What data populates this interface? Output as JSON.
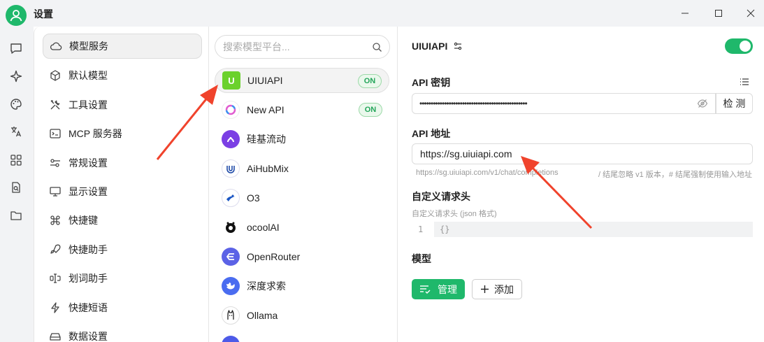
{
  "window": {
    "title": "设置"
  },
  "colors": {
    "accent": "#1fb86b",
    "arrow": "#f0432c"
  },
  "rail": {
    "icons": [
      "chat-icon",
      "sparkle-icon",
      "palette-icon",
      "translate-icon",
      "apps-grid-icon",
      "doc-search-icon",
      "folder-icon"
    ]
  },
  "nav": {
    "items": [
      {
        "label": "模型服务",
        "icon": "cloud-icon"
      },
      {
        "label": "默认模型",
        "icon": "cube-icon"
      },
      {
        "label": "工具设置",
        "icon": "tools-icon"
      },
      {
        "label": "MCP 服务器",
        "icon": "terminal-icon"
      },
      {
        "label": "常规设置",
        "icon": "sliders-icon"
      },
      {
        "label": "显示设置",
        "icon": "monitor-icon"
      },
      {
        "label": "快捷键",
        "icon": "command-icon"
      },
      {
        "label": "快捷助手",
        "icon": "rocket-icon"
      },
      {
        "label": "划词助手",
        "icon": "text-cursor-icon"
      },
      {
        "label": "快捷短语",
        "icon": "zap-icon"
      },
      {
        "label": "数据设置",
        "icon": "database-icon"
      }
    ]
  },
  "providers": {
    "search_placeholder": "搜索模型平台...",
    "on_label": "ON",
    "items": [
      {
        "name": "UIUIAPI",
        "logo_text": "U",
        "on": true
      },
      {
        "name": "New API",
        "logo_text": "",
        "on": true
      },
      {
        "name": "硅基流动",
        "logo_text": "",
        "on": false
      },
      {
        "name": "AiHubMix",
        "logo_text": "",
        "on": false
      },
      {
        "name": "O3",
        "logo_text": "",
        "on": false
      },
      {
        "name": "ocoolAI",
        "logo_text": "",
        "on": false
      },
      {
        "name": "OpenRouter",
        "logo_text": "",
        "on": false
      },
      {
        "name": "深度求索",
        "logo_text": "",
        "on": false
      },
      {
        "name": "Ollama",
        "logo_text": "",
        "on": false
      }
    ]
  },
  "detail": {
    "provider_name": "UIUIAPI",
    "enabled": true,
    "api_key_label": "API 密钥",
    "api_key_value": "••••••••••••••••••••••••••••••••••••••••••••••••",
    "check_label": "检 测",
    "api_url_label": "API 地址",
    "api_url_value": "https://sg.uiuiapi.com",
    "url_hint_preview": "https://sg.uiuiapi.com/v1/chat/completions",
    "url_hint_rule": "/ 结尾忽略 v1 版本，# 结尾强制使用输入地址",
    "headers_label": "自定义请求头",
    "headers_hint": "自定义请求头 (json 格式)",
    "headers_line_no": "1",
    "headers_code": "{}",
    "models_label": "模型",
    "manage_label": "管理",
    "add_label": "添加"
  }
}
